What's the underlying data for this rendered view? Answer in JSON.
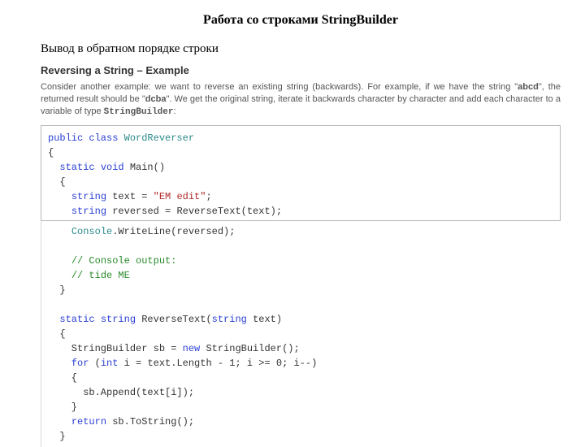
{
  "page": {
    "title": "Работа со строками StringBuilder",
    "subtitle": "Вывод в обратном порядке строки",
    "section_heading": "Reversing a String – Example",
    "body_pre": "Consider another example: we want to reverse an existing string (backwards). For example, if we have the string \"",
    "body_bold1": "abcd",
    "body_mid": "\", the returned result should be \"",
    "body_bold2": "dcba",
    "body_post1": "\". We get the original string, iterate it backwards character by character and add each character to a variable of type ",
    "body_mono": "StringBuilder",
    "body_post2": ":"
  },
  "code1": {
    "l1_kw": "public class",
    "l1_type": " WordReverser",
    "l2": "{",
    "l3_kw": "static void",
    "l3_rest": " Main()",
    "l4": "  {",
    "l5_kw": "string",
    "l5_rest": " text = ",
    "l5_str": "\"EM edit\"",
    "l5_end": ";",
    "l6_kw": "string",
    "l6_rest": " reversed = ReverseText(text);"
  },
  "code2": {
    "l7_type": "Console",
    "l7_rest": ".WriteLine(reversed);",
    "l8_cmt": "// Console output:",
    "l9_cmt": "// tide ME",
    "l10": "  }",
    "l11_kw": "static string",
    "l11_rest": " ReverseText(",
    "l11_kw2": "string",
    "l11_rest2": " text)",
    "l12": "  {",
    "l13_rest1": "    StringBuilder sb = ",
    "l13_kw": "new",
    "l13_rest2": " StringBuilder();",
    "l14_kw1": "for",
    "l14_rest1": " (",
    "l14_kw2": "int",
    "l14_rest2": " i = text.Length - 1; i >= 0; i--)",
    "l15": "    {",
    "l16": "      sb.Append(text[i]);",
    "l17": "    }",
    "l18_kw": "return",
    "l18_rest": " sb.ToString();",
    "l19": "  }"
  }
}
